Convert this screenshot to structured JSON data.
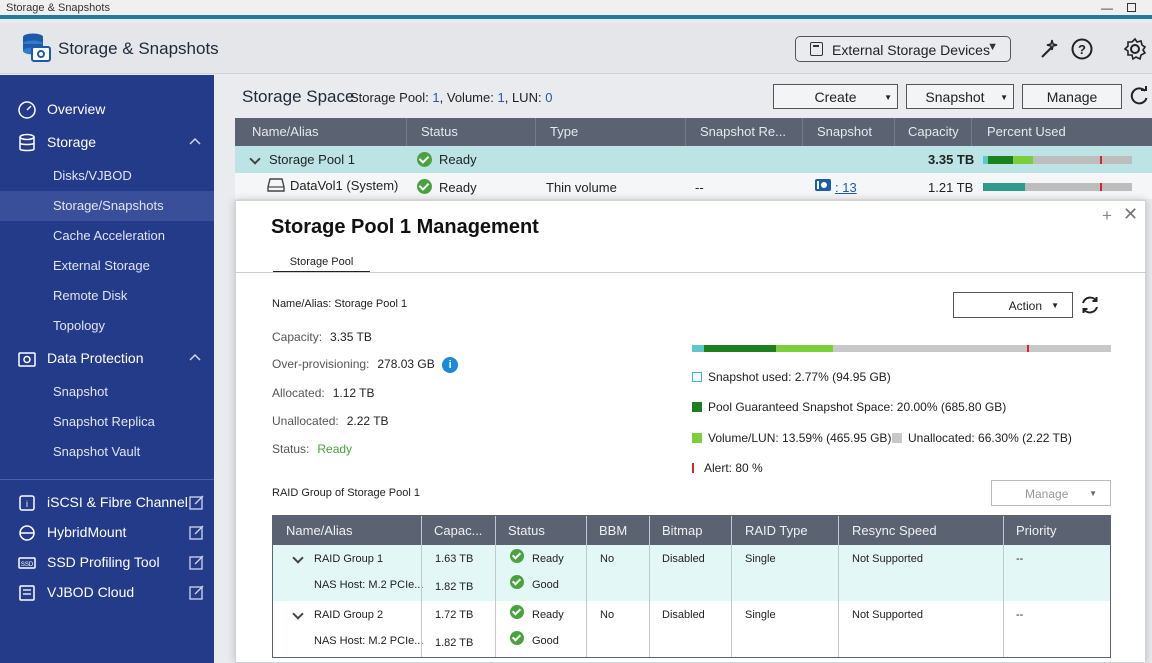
{
  "window": {
    "title": "Storage & Snapshots"
  },
  "app": {
    "title": "Storage & Snapshots",
    "external_button": "External Storage Devices"
  },
  "sidebar": {
    "overview": "Overview",
    "storage": "Storage",
    "storage_items": [
      "Disks/VJBOD",
      "Storage/Snapshots",
      "Cache Acceleration",
      "External Storage",
      "Remote Disk",
      "Topology"
    ],
    "data_protection": "Data Protection",
    "dp_items": [
      "Snapshot",
      "Snapshot Replica",
      "Snapshot Vault"
    ],
    "links": [
      "iSCSI & Fibre Channel",
      "HybridMount",
      "SSD Profiling Tool",
      "VJBOD Cloud"
    ]
  },
  "storage_space": {
    "title": "Storage Space",
    "summary_pool_label": "Storage Pool:",
    "summary_pool": "1",
    "summary_volume_label": "Volume:",
    "summary_volume": "1",
    "summary_lun_label": "LUN:",
    "summary_lun": "0",
    "buttons": {
      "create": "Create",
      "snapshot": "Snapshot",
      "manage": "Manage"
    },
    "columns": [
      "Name/Alias",
      "Status",
      "Type",
      "Snapshot Re...",
      "Snapshot",
      "Capacity",
      "Percent Used"
    ],
    "rows": [
      {
        "name": "Storage Pool 1",
        "status": "Ready",
        "type": "",
        "snap_rep": "",
        "snapshot": "",
        "capacity": "3.35 TB",
        "used_fraction": 0.33
      },
      {
        "name": "DataVol1 (System)",
        "status": "Ready",
        "type": "Thin volume",
        "snap_rep": "--",
        "snapshot": ": 13",
        "capacity": "1.21 TB",
        "used_fraction": 0.28
      }
    ]
  },
  "modal": {
    "title": "Storage Pool 1 Management",
    "tab": "Storage Pool",
    "name_alias": "Name/Alias: Storage Pool 1",
    "capacity_label": "Capacity:",
    "capacity": "3.35 TB",
    "overprov_label": "Over-provisioning:",
    "overprov": "278.03 GB",
    "allocated_label": "Allocated:",
    "allocated": "1.12 TB",
    "unallocated_label": "Unallocated:",
    "unallocated": "2.22 TB",
    "status_label": "Status:",
    "status": "Ready",
    "action_button": "Action",
    "bar": {
      "snapshot_used": 0.0277,
      "guaranteed": 0.2,
      "volume_lun": 0.1359,
      "alert": 0.8
    },
    "legend": {
      "snapshot_used": "Snapshot used: 2.77% (94.95 GB)",
      "guaranteed": "Pool Guaranteed Snapshot Space: 20.00% (685.80 GB)",
      "volume_lun": "Volume/LUN: 13.59% (465.95 GB)",
      "unallocated": "Unallocated: 66.30% (2.22 TB)",
      "alert": "Alert: 80 %"
    },
    "colors": {
      "snapshot_used": "#5ec7c7",
      "guaranteed": "#1e7f1e",
      "volume_lun": "#7ccf3c",
      "unallocated": "#c8c8c8",
      "alert": "#d9232e"
    },
    "raid_label": "RAID Group of Storage Pool 1",
    "manage_button": "Manage",
    "raid_columns": [
      "Name/Alias",
      "Capac...",
      "Status",
      "BBM",
      "Bitmap",
      "RAID Type",
      "Resync Speed",
      "Priority"
    ],
    "raid_rows": [
      {
        "name": "RAID Group 1",
        "capacity": "1.63 TB",
        "status": "Ready",
        "bbm": "No",
        "bitmap": "Disabled",
        "raid_type": "Single",
        "resync": "Not Supported",
        "priority": "--",
        "disk": "NAS Host: M.2 PCIe...",
        "disk_capacity": "1.82 TB",
        "disk_status": "Good"
      },
      {
        "name": "RAID Group 2",
        "capacity": "1.72 TB",
        "status": "Ready",
        "bbm": "No",
        "bitmap": "Disabled",
        "raid_type": "Single",
        "resync": "Not Supported",
        "priority": "--",
        "disk": "NAS Host: M.2 PCIe...",
        "disk_capacity": "1.82 TB",
        "disk_status": "Good"
      }
    ]
  }
}
